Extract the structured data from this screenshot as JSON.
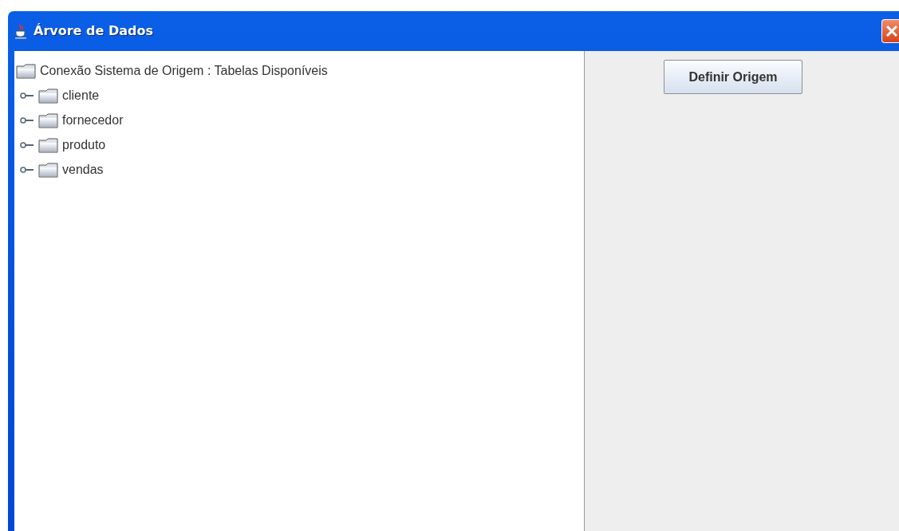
{
  "window": {
    "title": "Árvore de Dados"
  },
  "tree": {
    "root": {
      "label": "Conexão Sistema de Origem : Tabelas Disponíveis",
      "children": [
        {
          "label": "cliente",
          "expanded": false
        },
        {
          "label": "fornecedor",
          "expanded": false
        },
        {
          "label": "produto",
          "expanded": false
        },
        {
          "label": "vendas",
          "expanded": false
        }
      ]
    }
  },
  "buttons": [
    {
      "label": "Definir Origem"
    }
  ]
}
